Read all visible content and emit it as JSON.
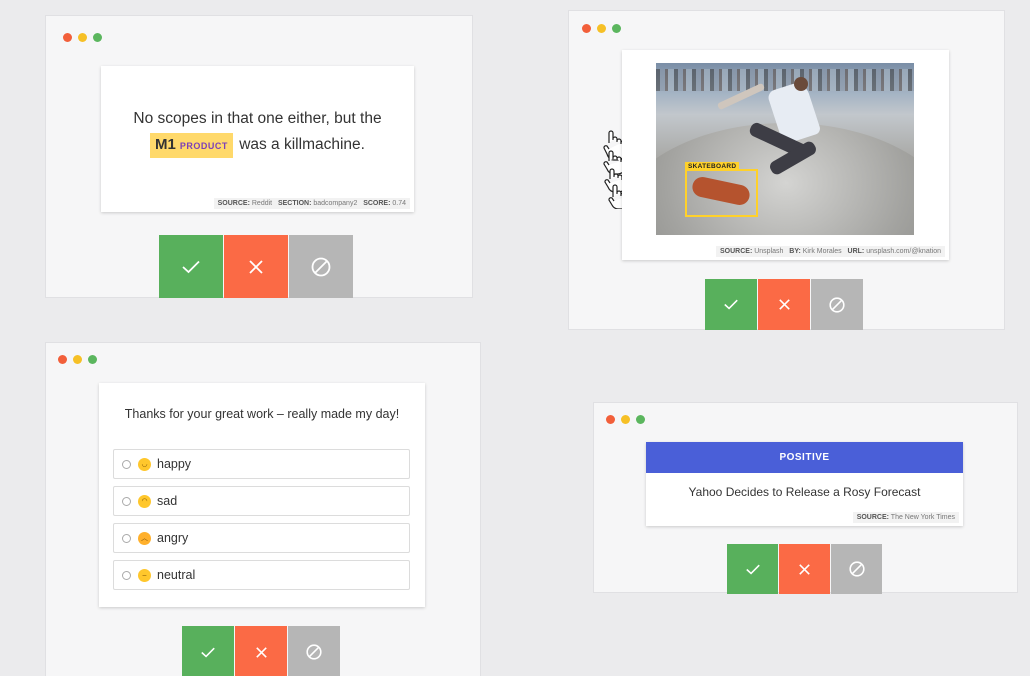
{
  "ner_window": {
    "text_before": "No scopes in that one either, but the",
    "entity_word": "M1",
    "entity_label": "PRODUCT",
    "text_after": "was a killmachine.",
    "meta": {
      "source_key": "SOURCE:",
      "source_val": "Reddit",
      "section_key": "SECTION:",
      "section_val": "badcompany2",
      "score_key": "SCORE:",
      "score_val": "0.74"
    }
  },
  "image_window": {
    "bbox_label": "SKATEBOARD",
    "meta": {
      "source_key": "SOURCE:",
      "source_val": "Unsplash",
      "by_key": "BY:",
      "by_val": "Kirk Morales",
      "url_key": "URL:",
      "url_val": "unsplash.com/@knation"
    }
  },
  "choice_window": {
    "question": "Thanks for your great work – really made my day!",
    "options": [
      {
        "label": "happy",
        "emoji": "happy-emoji"
      },
      {
        "label": "sad",
        "emoji": "sad-emoji"
      },
      {
        "label": "angry",
        "emoji": "angry-emoji"
      },
      {
        "label": "neutral",
        "emoji": "neutral-emoji"
      }
    ]
  },
  "textcat_window": {
    "label": "POSITIVE",
    "headline": "Yahoo Decides to Release a Rosy Forecast",
    "meta": {
      "source_key": "SOURCE:",
      "source_val": "The New York Times"
    }
  },
  "colors": {
    "accept": "#58b05c",
    "reject": "#fb6a45",
    "ignore": "#b6b6b6",
    "highlight": "#ffd96b",
    "positive_bar": "#4a5fd8"
  },
  "icons": {
    "accept": "check-icon",
    "reject": "x-icon",
    "ignore": "ignore-icon"
  }
}
